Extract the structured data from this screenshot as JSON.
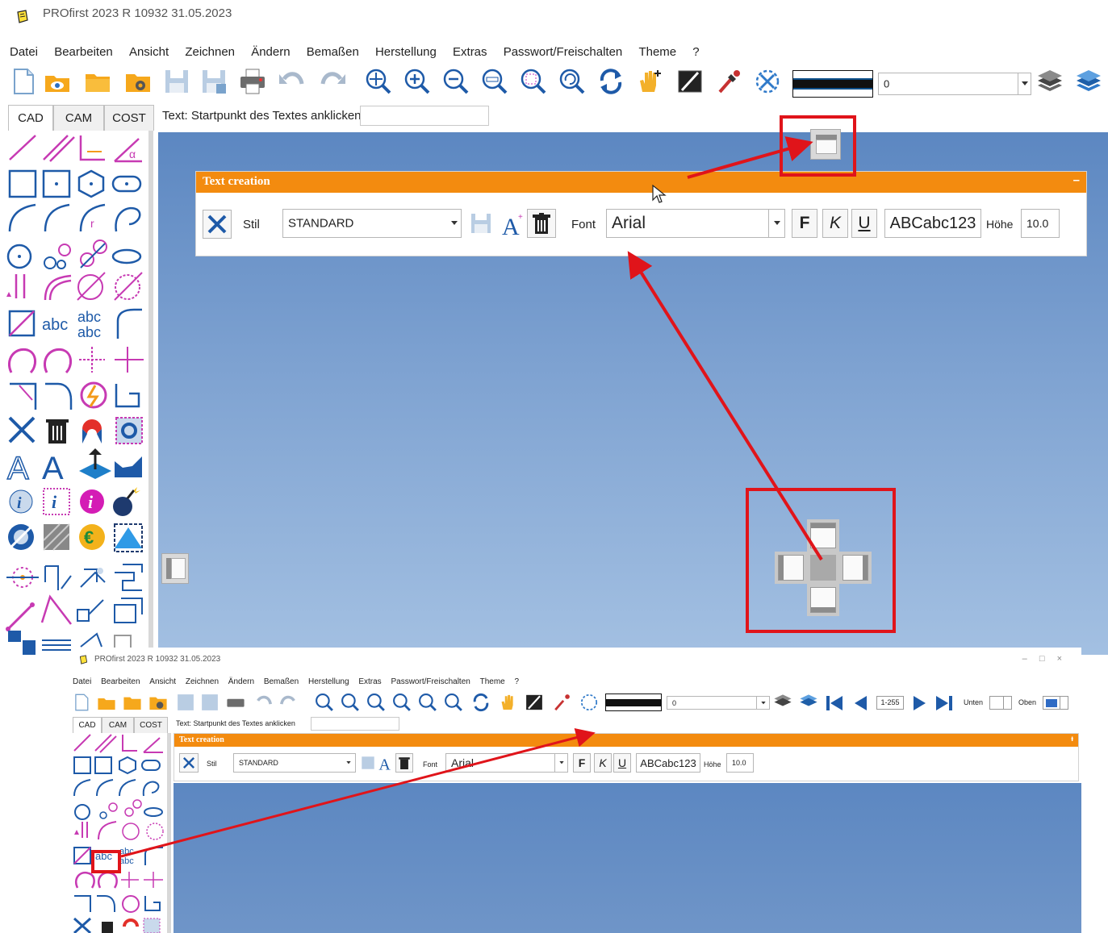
{
  "window_top": {
    "title": "PROfirst 2023 R 10932   31.05.2023",
    "menu": [
      "Datei",
      "Bearbeiten",
      "Ansicht",
      "Zeichnen",
      "Ändern",
      "Bemaßen",
      "Herstellung",
      "Extras",
      "Passwort/Freischalten",
      "Theme",
      "?"
    ],
    "layer_combo_value": "0",
    "tabs": [
      "CAD",
      "CAM",
      "COST"
    ],
    "active_tab": "CAD",
    "hint": "Text: Startpunkt des Textes anklicken",
    "sidebar_texts": {
      "abc": "abc",
      "abc2a": "abc",
      "abc2b": "abc",
      "euro": "€",
      "info": "i"
    },
    "text_panel": {
      "title": "Text creation",
      "collapse_glyph": "–",
      "style_label": "Stil",
      "style_value": "STANDARD",
      "font_label": "Font",
      "font_value": "Arial",
      "bold": "F",
      "italic": "K",
      "underline": "U",
      "preview": "ABCabc123",
      "height_label": "Höhe",
      "height_value": "10.0"
    }
  },
  "window_bottom": {
    "title": "PROfirst 2023 R 10932   31.05.2023",
    "window_controls": [
      "–",
      "□",
      "×"
    ],
    "menu": [
      "Datei",
      "Bearbeiten",
      "Ansicht",
      "Zeichnen",
      "Ändern",
      "Bemaßen",
      "Herstellung",
      "Extras",
      "Passwort/Freischalten",
      "Theme",
      "?"
    ],
    "layer_combo_value": "0",
    "range_value": "1-255",
    "lower_label": "Unten",
    "upper_label": "Oben",
    "tabs": [
      "CAD",
      "CAM",
      "COST"
    ],
    "hint": "Text: Startpunkt des Textes anklicken",
    "sidebar_abc": "abc",
    "text_panel": {
      "title": "Text creation",
      "pin_glyph": "ᵻ",
      "style_label": "Stil",
      "style_value": "STANDARD",
      "font_label": "Font",
      "font_value": "Arial",
      "bold": "F",
      "italic": "K",
      "underline": "U",
      "preview": "ABCabc123",
      "height_label": "Höhe",
      "height_value": "10.0"
    }
  },
  "colors": {
    "accent_orange": "#f38b0f",
    "annotation_red": "#e0141a",
    "canvas_top": "#5c87c1",
    "canvas_bottom": "#a3c0e2"
  }
}
